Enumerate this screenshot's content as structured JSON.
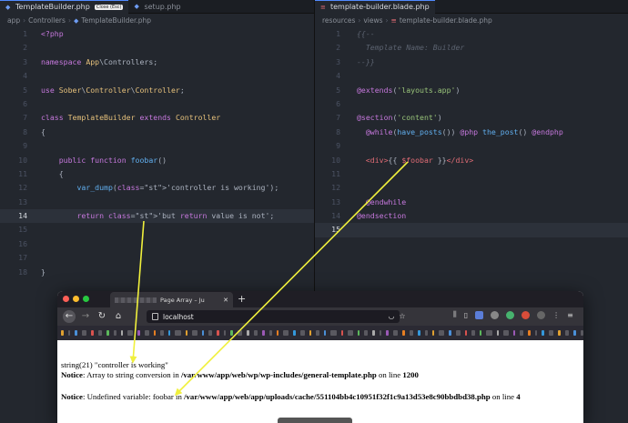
{
  "left_pane": {
    "tabs": [
      {
        "label": "TemplateBuilder.php",
        "tooltip": "Close (Esc)"
      },
      {
        "label": "setup.php"
      }
    ],
    "breadcrumb": [
      "app",
      "Controllers",
      "TemplateBuilder.php"
    ],
    "lines": [
      {
        "n": "1",
        "t": "<?php"
      },
      {
        "n": "2",
        "t": ""
      },
      {
        "n": "3",
        "t": "namespace App\\Controllers;"
      },
      {
        "n": "4",
        "t": ""
      },
      {
        "n": "5",
        "t": "use Sober\\Controller\\Controller;"
      },
      {
        "n": "6",
        "t": ""
      },
      {
        "n": "7",
        "t": "class TemplateBuilder extends Controller"
      },
      {
        "n": "8",
        "t": "{"
      },
      {
        "n": "9",
        "t": ""
      },
      {
        "n": "10",
        "t": "    public function foobar()"
      },
      {
        "n": "11",
        "t": "    {"
      },
      {
        "n": "12",
        "t": "        var_dump('controller is working');"
      },
      {
        "n": "13",
        "t": ""
      },
      {
        "n": "14",
        "t": "        return 'but return value is not';"
      },
      {
        "n": "15",
        "t": ""
      },
      {
        "n": "16",
        "t": ""
      },
      {
        "n": "17",
        "t": ""
      },
      {
        "n": "18",
        "t": "}"
      }
    ],
    "current_line": "14"
  },
  "right_pane": {
    "tabs": [
      {
        "label": "template-builder.blade.php"
      }
    ],
    "breadcrumb": [
      "resources",
      "views",
      "template-builder.blade.php"
    ],
    "lines": [
      {
        "n": "1",
        "t": "{{--"
      },
      {
        "n": "2",
        "t": "  Template Name: Builder"
      },
      {
        "n": "3",
        "t": "--}}"
      },
      {
        "n": "4",
        "t": ""
      },
      {
        "n": "5",
        "t": "@extends('layouts.app')"
      },
      {
        "n": "6",
        "t": ""
      },
      {
        "n": "7",
        "t": "@section('content')"
      },
      {
        "n": "8",
        "t": "  @while(have_posts()) @php the_post() @endphp"
      },
      {
        "n": "9",
        "t": ""
      },
      {
        "n": "10",
        "t": "  <div>{{ $foobar }}</div>"
      },
      {
        "n": "11",
        "t": ""
      },
      {
        "n": "12",
        "t": ""
      },
      {
        "n": "13",
        "t": "  @endwhile"
      },
      {
        "n": "14",
        "t": "@endsection"
      },
      {
        "n": "15",
        "t": ""
      }
    ],
    "current_line": "15"
  },
  "browser": {
    "tab_title": "Page Array – Ju",
    "url": "localhost",
    "output": {
      "line1": "string(21) \"controller is working\"",
      "notice1_label": "Notice",
      "notice1_msg": ": Array to string conversion in ",
      "notice1_path": "/var/www/app/web/wp/wp-includes/general-template.php",
      "notice1_on": " on line ",
      "notice1_line": "1200",
      "notice2_label": "Notice",
      "notice2_msg": ": Undefined variable: foobar in ",
      "notice2_path": "/var/www/app/web/app/uploads/cache/551104bb4c10951f32f1c9a13d53e8c90bbdbd38.php",
      "notice2_on": " on line ",
      "notice2_line": "4"
    }
  },
  "colors": {
    "arrow": "#f0f03c",
    "editor_bg": "#23272e",
    "accent": "#528bff"
  }
}
